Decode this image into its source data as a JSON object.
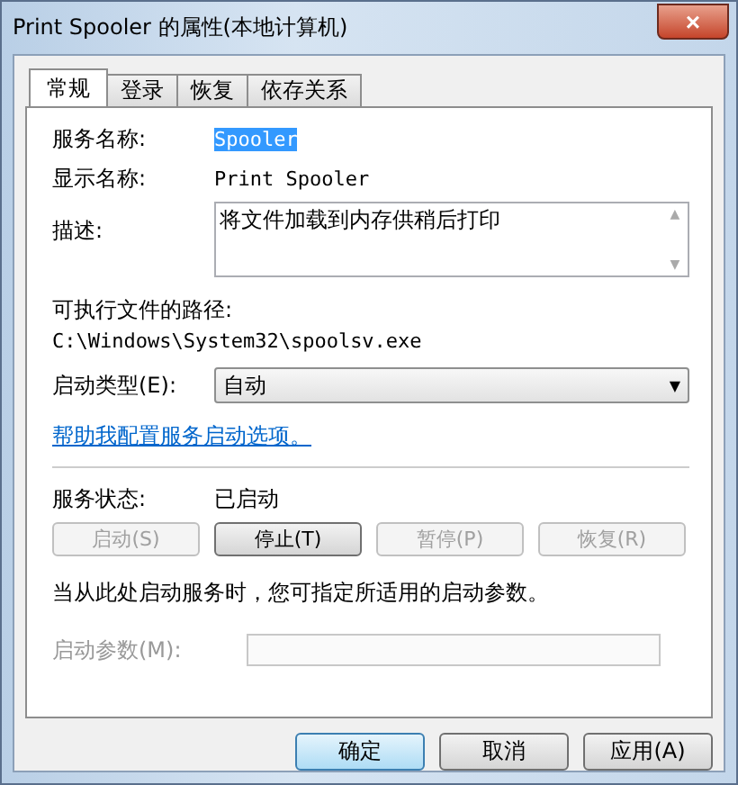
{
  "window": {
    "title": "Print Spooler 的属性(本地计算机)",
    "close": "×"
  },
  "tabs": [
    {
      "label": "常规",
      "selected": true
    },
    {
      "label": "登录",
      "selected": false
    },
    {
      "label": "恢复",
      "selected": false
    },
    {
      "label": "依存关系",
      "selected": false
    }
  ],
  "service_name": {
    "label": "服务名称:",
    "value": "Spooler",
    "selected": true
  },
  "display_name": {
    "label": "显示名称:",
    "value": "Print Spooler"
  },
  "description": {
    "label": "描述:",
    "value": "将文件加载到内存供稍后打印",
    "scroll_up": "▲",
    "scroll_down": "▼"
  },
  "path": {
    "label": "可执行文件的路径:",
    "value": "C:\\Windows\\System32\\spoolsv.exe"
  },
  "startup_type": {
    "label": "启动类型(E):",
    "value": "自动",
    "arrow": "▼"
  },
  "help_link": "帮助我配置服务启动选项。",
  "status": {
    "label": "服务状态:",
    "value": "已启动"
  },
  "service_buttons": [
    {
      "label": "启动(S)",
      "disabled": true
    },
    {
      "label": "停止(T)",
      "disabled": false
    },
    {
      "label": "暂停(P)",
      "disabled": true
    },
    {
      "label": "恢复(R)",
      "disabled": true
    }
  ],
  "hint": "当从此处启动服务时，您可指定所适用的启动参数。",
  "start_params": {
    "label": "启动参数(M):",
    "disabled": true
  },
  "dialog_buttons": [
    {
      "label": "确定",
      "default": true
    },
    {
      "label": "取消",
      "default": false
    },
    {
      "label": "应用(A)",
      "default": false
    }
  ]
}
